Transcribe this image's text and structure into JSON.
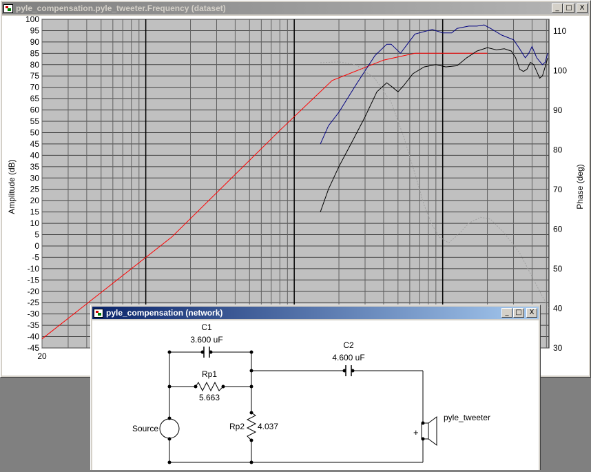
{
  "dataset_window": {
    "title": "pyle_compensation.pyle_tweeter.Frequency (dataset)",
    "buttons": {
      "minimize": "_",
      "maximize": "□",
      "close": "X"
    }
  },
  "network_window": {
    "title": "pyle_compensation (network)",
    "buttons": {
      "minimize": "_",
      "maximize": "□",
      "close": "X"
    }
  },
  "chart_data": {
    "type": "line",
    "xlabel": "",
    "ylabel": "Amplitude (dB)",
    "ylabel_right": "Phase (deg)",
    "x_scale": "log",
    "x_tick_labels": [
      "20"
    ],
    "ylim": [
      -45,
      100
    ],
    "ylim_right": [
      30,
      110
    ],
    "y_ticks": [
      100,
      95,
      90,
      85,
      80,
      75,
      70,
      65,
      60,
      55,
      50,
      45,
      40,
      35,
      30,
      25,
      20,
      15,
      10,
      5,
      0,
      -5,
      -10,
      -15,
      -20,
      -25,
      -30,
      -35,
      -40,
      -45
    ],
    "y_ticks_right": [
      110,
      100,
      90,
      80,
      70,
      60,
      50,
      40,
      30
    ],
    "grid": true,
    "series": [
      {
        "color": "#ff0000",
        "style": "solid",
        "axis": "left",
        "points": [
          [
            20,
            -41
          ],
          [
            150,
            4
          ],
          [
            800,
            51
          ],
          [
            1800,
            73
          ],
          [
            4000,
            82
          ],
          [
            6500,
            85
          ],
          [
            20000,
            85
          ]
        ]
      },
      {
        "color": "#000080",
        "style": "solid",
        "axis": "left",
        "points": [
          [
            1500,
            45
          ],
          [
            1700,
            53
          ],
          [
            2000,
            59
          ],
          [
            2600,
            71
          ],
          [
            3500,
            84
          ],
          [
            4200,
            89
          ],
          [
            4500,
            89
          ],
          [
            5200,
            85
          ],
          [
            6500,
            93.5
          ],
          [
            8500,
            95.5
          ],
          [
            10000,
            94
          ],
          [
            11500,
            94
          ],
          [
            12500,
            96
          ],
          [
            15000,
            97
          ],
          [
            17000,
            97
          ],
          [
            19000,
            97.5
          ],
          [
            21000,
            96
          ],
          [
            25000,
            93
          ],
          [
            30000,
            91
          ],
          [
            33000,
            87
          ],
          [
            36000,
            83
          ],
          [
            38000,
            85
          ],
          [
            40000,
            88
          ],
          [
            43000,
            83
          ],
          [
            47000,
            80
          ],
          [
            49000,
            81
          ],
          [
            51000,
            85
          ]
        ]
      },
      {
        "color": "#000000",
        "style": "solid",
        "axis": "left",
        "points": [
          [
            1500,
            15
          ],
          [
            1700,
            25
          ],
          [
            2000,
            35
          ],
          [
            2500,
            47
          ],
          [
            3000,
            57
          ],
          [
            3600,
            68
          ],
          [
            4200,
            72
          ],
          [
            4600,
            70
          ],
          [
            5000,
            68
          ],
          [
            5500,
            71
          ],
          [
            6300,
            76
          ],
          [
            7500,
            79
          ],
          [
            9000,
            80
          ],
          [
            10500,
            79
          ],
          [
            12500,
            79.5
          ],
          [
            14500,
            83
          ],
          [
            17000,
            86
          ],
          [
            20000,
            87.5
          ],
          [
            23000,
            86.5
          ],
          [
            26000,
            87
          ],
          [
            29000,
            86
          ],
          [
            31000,
            83
          ],
          [
            33000,
            78
          ],
          [
            35000,
            77
          ],
          [
            37000,
            78
          ],
          [
            39000,
            81
          ],
          [
            41000,
            80
          ],
          [
            43000,
            77
          ],
          [
            45000,
            74
          ],
          [
            47000,
            75
          ],
          [
            49000,
            79
          ],
          [
            51000,
            83
          ]
        ]
      },
      {
        "color": "#a0a0a0",
        "style": "dashed",
        "axis": "right",
        "points": [
          [
            1500,
            102
          ],
          [
            2000,
            102.2
          ],
          [
            2600,
            101.5
          ],
          [
            3500,
            98
          ],
          [
            4500,
            92
          ],
          [
            5500,
            83
          ],
          [
            6500,
            74
          ],
          [
            7500,
            66
          ],
          [
            8500,
            61
          ],
          [
            9500,
            58
          ],
          [
            11000,
            56.5
          ],
          [
            13000,
            59
          ],
          [
            15000,
            61.5
          ],
          [
            18000,
            63
          ],
          [
            21000,
            62.5
          ],
          [
            26000,
            59
          ],
          [
            33000,
            54
          ],
          [
            40000,
            48
          ],
          [
            47000,
            43
          ],
          [
            52000,
            40
          ]
        ]
      }
    ]
  },
  "schematic": {
    "c1_name": "C1",
    "c1_value": "3.600 uF",
    "rp1_name": "Rp1",
    "rp1_value": "5.663",
    "rp2_name": "Rp2",
    "rp2_value": "4.037",
    "c2_name": "C2",
    "c2_value": "4.600 uF",
    "source_label": "Source",
    "speaker_label": "pyle_tweeter",
    "plus_sign": "+"
  }
}
